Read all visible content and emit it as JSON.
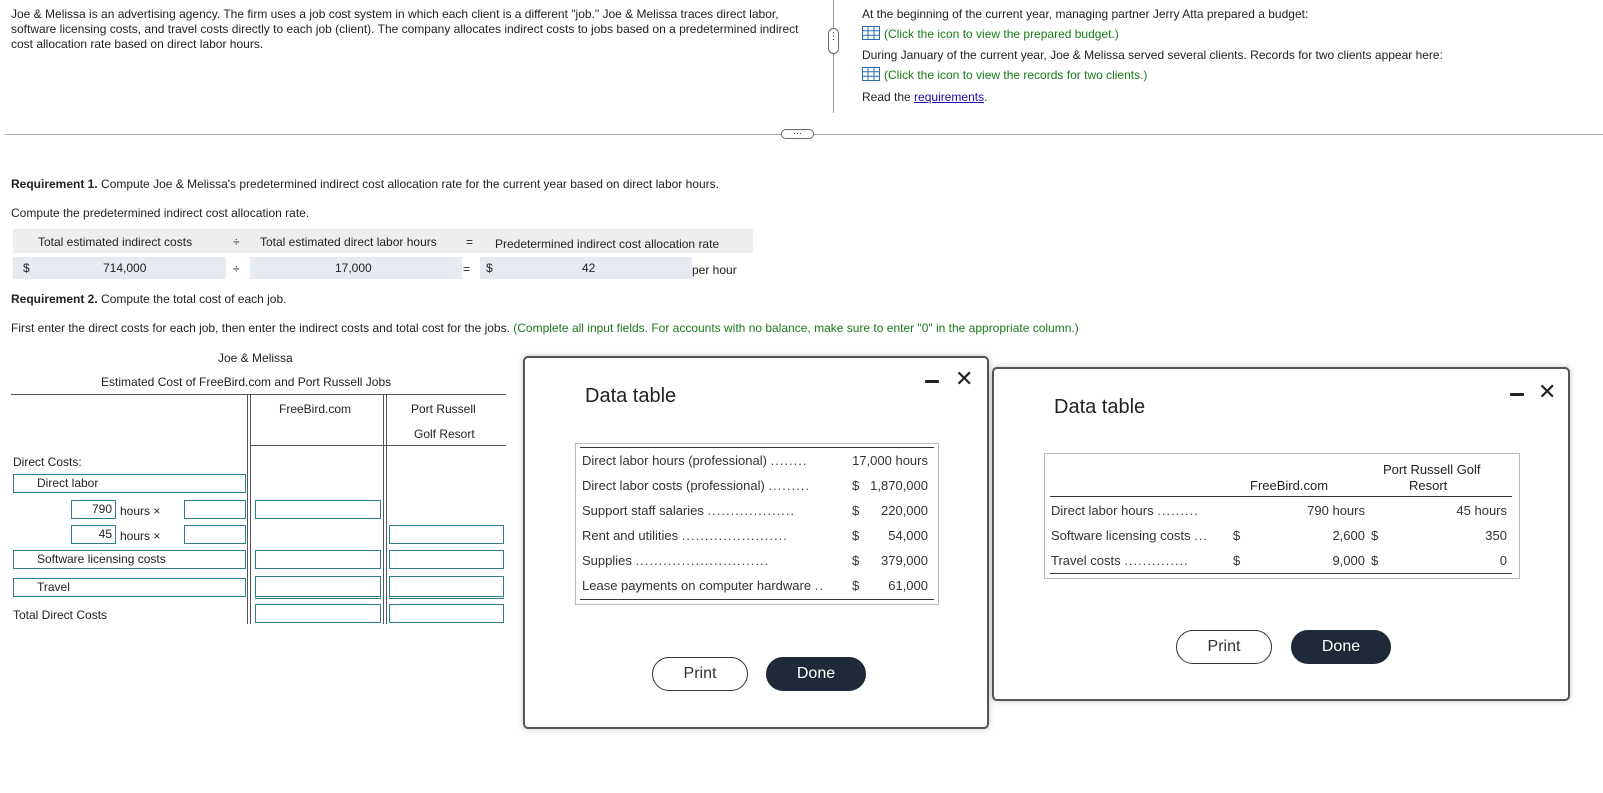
{
  "intro": {
    "left_text": "Joe & Melissa is an advertising agency. The firm uses a job cost system in which each client is a different \"job.\" Joe & Melissa traces direct labor, software licensing costs, and travel costs directly to each job (client). The company allocates indirect costs to jobs based on a predetermined indirect cost allocation rate based on direct labor hours.",
    "right_line1": "At the beginning of the current year, managing partner Jerry Atta prepared a budget:",
    "right_link1": "(Click the icon to view the prepared budget.)",
    "right_line2": "During January of the current year, Joe & Melissa served several clients. Records for two clients appear here:",
    "right_link2": "(Click the icon to view the records for two clients.)",
    "read_prefix": "Read the ",
    "read_link": "requirements",
    "read_suffix": "."
  },
  "req1": {
    "label_bold": "Requirement 1.",
    "label_text": " Compute Joe & Melissa's predetermined indirect cost allocation rate for the current year based on direct labor hours.",
    "instruction": "Compute the predetermined indirect cost allocation rate.",
    "col1_header": "Total estimated indirect costs",
    "div_sign": "÷",
    "col2_header": "Total estimated direct labor hours",
    "eq_sign": "=",
    "col3_header": "Predetermined indirect cost allocation rate",
    "dollar": "$",
    "indirect_costs": "714,000",
    "labor_hours": "17,000",
    "rate": "42",
    "per_hour": "per hour"
  },
  "req2": {
    "label_bold": "Requirement 2.",
    "label_text": " Compute the total cost of each job.",
    "instruction": "First enter the direct costs for each job, then enter the indirect costs and total cost for the jobs.",
    "instruction_green": " (Complete all input fields. For accounts with no balance, make sure to enter \"0\" in the appropriate column.)",
    "table_title1": "Joe & Melissa",
    "table_title2": "Estimated Cost of FreeBird.com and Port Russell Jobs",
    "col_freebird": "FreeBird.com",
    "col_port1": "Port Russell",
    "col_port2": "Golf Resort",
    "direct_costs": "Direct Costs:",
    "direct_labor": "Direct labor",
    "hours1": "790",
    "hours2": "45",
    "hours_x": "hours ×",
    "software": "Software licensing costs",
    "travel": "Travel",
    "total_direct": "Total Direct Costs"
  },
  "dialog1": {
    "title": "Data table",
    "rows": [
      {
        "label": "Direct labor hours (professional)",
        "dots": "........",
        "sym": "",
        "value": "17,000 hours"
      },
      {
        "label": "Direct labor costs (professional)",
        "dots": ".........",
        "sym": "$",
        "value": "1,870,000"
      },
      {
        "label": "Support staff salaries",
        "dots": "...................",
        "sym": "$",
        "value": "220,000"
      },
      {
        "label": "Rent and utilities",
        "dots": ".......................",
        "sym": "$",
        "value": "54,000"
      },
      {
        "label": "Supplies",
        "dots": ".............................",
        "sym": "$",
        "value": "379,000"
      },
      {
        "label": "Lease payments on computer hardware",
        "dots": "..",
        "sym": "$",
        "value": "61,000"
      }
    ],
    "print": "Print",
    "done": "Done"
  },
  "dialog2": {
    "title": "Data table",
    "col_freebird": "FreeBird.com",
    "col_port1": "Port Russell Golf",
    "col_port2": "Resort",
    "rows": [
      {
        "label": "Direct labor hours",
        "dots": ".........",
        "sym1": "",
        "fb": "790 hours",
        "sym2": "",
        "pr": "45 hours"
      },
      {
        "label": "Software licensing costs",
        "dots": "...",
        "sym1": "$",
        "fb": "2,600",
        "sym2": "$",
        "pr": "350"
      },
      {
        "label": "Travel costs",
        "dots": "..............",
        "sym1": "$",
        "fb": "9,000",
        "sym2": "$",
        "pr": "0"
      }
    ],
    "print": "Print",
    "done": "Done"
  }
}
